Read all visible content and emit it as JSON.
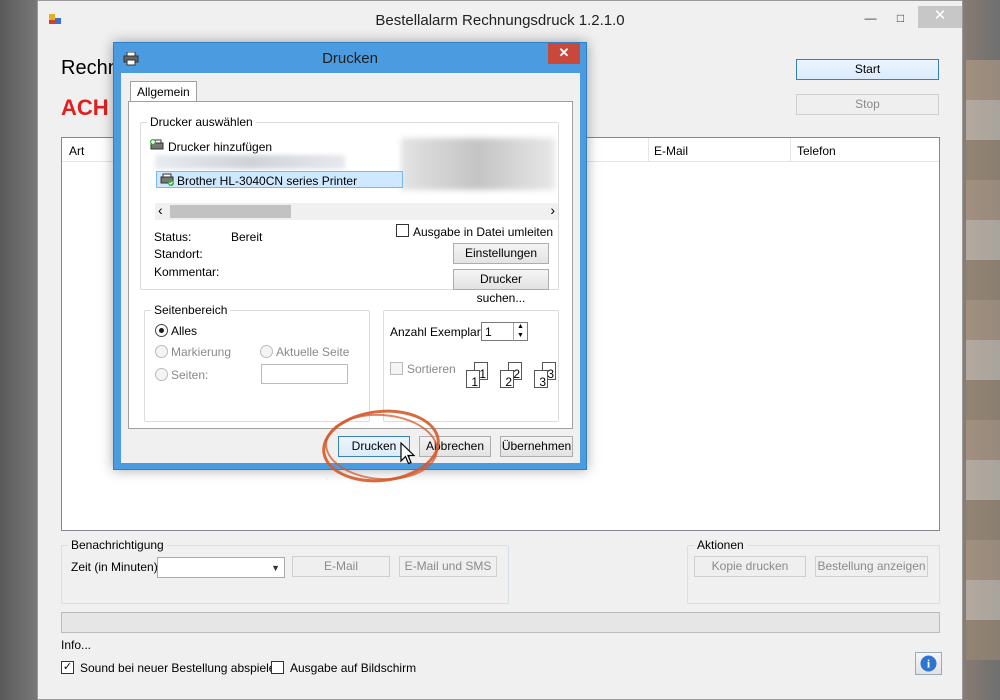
{
  "main_window": {
    "title": "Bestellalarm Rechnungsdruck 1.2.1.0",
    "controls": {
      "minimize": "—",
      "maximize": "□",
      "close": "✕"
    },
    "heading_partial": "Rechn",
    "alert_partial": "ACH",
    "buttons": {
      "start": "Start",
      "stop": "Stop"
    },
    "list": {
      "columns": [
        "Art",
        "E-Mail",
        "Telefon"
      ]
    },
    "benachrichtigung": {
      "title": "Benachrichtigung",
      "zeit_label": "Zeit (in Minuten)",
      "zeit_value": "",
      "email_button": "E-Mail",
      "email_sms_button": "E-Mail und SMS"
    },
    "aktionen": {
      "title": "Aktionen",
      "kopie_button": "Kopie drucken",
      "bestellung_button": "Bestellung anzeigen"
    },
    "info_label": "Info...",
    "sound_checkbox": {
      "label": "Sound bei neuer Bestellung abspielen",
      "checked": true
    },
    "ausgabe_checkbox": {
      "label": "Ausgabe auf Bildschirm",
      "checked": false
    },
    "check_mark": "✓",
    "info_icon": "i"
  },
  "print_dialog": {
    "title": "Drucken",
    "close": "✕",
    "tab": "Allgemein",
    "printer_group": {
      "title": "Drucker auswählen",
      "items": [
        "Drucker hinzufügen",
        "Brother HL-3040CN series Printer"
      ],
      "selected_index": 1
    },
    "status": {
      "status_label": "Status:",
      "status_value": "Bereit",
      "standort_label": "Standort:",
      "standort_value": "",
      "kommentar_label": "Kommentar:",
      "kommentar_value": ""
    },
    "print_to_file": {
      "label": "Ausgabe in Datei umleiten",
      "checked": false
    },
    "buttons": {
      "einstellungen": "Einstellungen",
      "drucker_suchen": "Drucker suchen...",
      "drucken": "Drucken",
      "abbrechen": "Abbrechen",
      "uebernehmen": "Übernehmen"
    },
    "seitenbereich": {
      "title": "Seitenbereich",
      "alles": "Alles",
      "markierung": "Markierung",
      "aktuelle_seite": "Aktuelle Seite",
      "seiten": "Seiten:",
      "selected": "Alles"
    },
    "copies": {
      "label": "Anzahl Exemplare:",
      "value": "1",
      "sortieren": "Sortieren",
      "page_numbers": [
        "1",
        "1",
        "2",
        "2",
        "3",
        "3"
      ]
    },
    "scroll_left": "‹",
    "scroll_right": "›",
    "spin_up": "▲",
    "spin_down": "▼"
  },
  "colors": {
    "dialog_border": "#4a9be0",
    "close_red": "#c9483c",
    "alert_red": "#e02020",
    "annotation": "#d45a2c",
    "selection": "#cde8ff"
  }
}
